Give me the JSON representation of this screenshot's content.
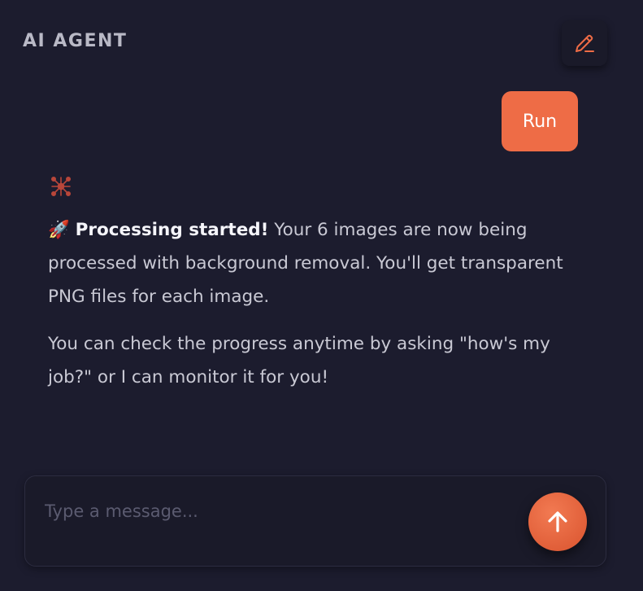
{
  "header": {
    "title": "AI AGENT",
    "edit_icon": "pencil-icon"
  },
  "conversation": {
    "user_message": "Run",
    "agent_icon": "network-node-icon",
    "agent_message": {
      "emoji": "🚀",
      "bold": "Processing started!",
      "line1_rest": " Your 6 images are now being processed with background removal. You'll get transparent PNG files for each image.",
      "line2": "You can check the progress anytime by asking \"how's my job?\" or I can monitor it for you!"
    }
  },
  "composer": {
    "placeholder": "Type a message...",
    "value": "",
    "send_icon": "arrow-up-icon"
  },
  "colors": {
    "background": "#1c1c2e",
    "accent": "#ee6c46"
  }
}
